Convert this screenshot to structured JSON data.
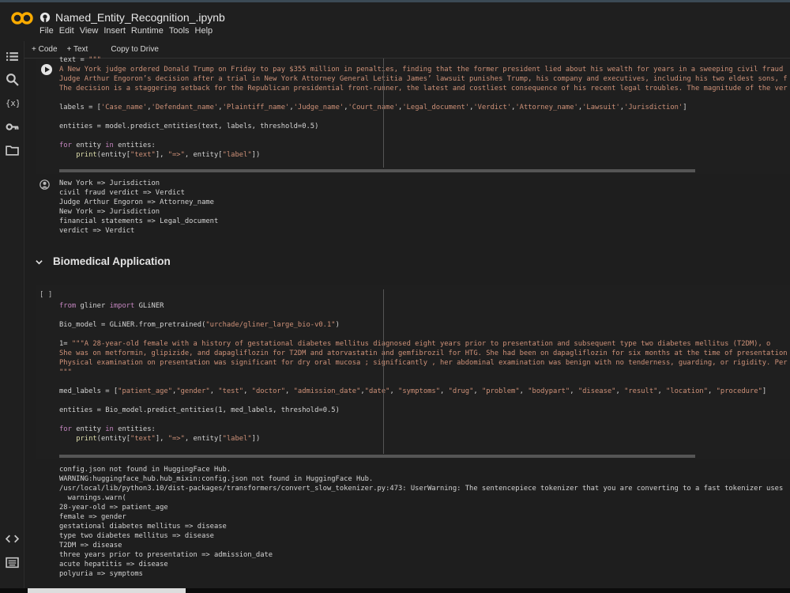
{
  "app": {
    "title": "Named_Entity_Recognition_.ipynb",
    "menu": [
      "File",
      "Edit",
      "View",
      "Insert",
      "Runtime",
      "Tools",
      "Help"
    ]
  },
  "toolbar": {
    "code_label": "+ Code",
    "text_label": "+ Text",
    "drive_label": "Copy to Drive"
  },
  "sidebar": {
    "icons": [
      "toc-icon",
      "search-icon",
      "variables-icon",
      "key-icon",
      "folder-icon",
      "code-snippets-icon",
      "terminal-icon"
    ]
  },
  "cell1": {
    "lines": [
      "text = \"\"\"",
      "A New York judge ordered Donald Trump on Friday to pay $355 million in penalties, finding that the former president lied about his wealth for years in a sweeping civil fraud",
      "Judge Arthur Engoron’s decision after a trial in New York Attorney General Letitia James’ lawsuit punishes Trump, his company and executives, including his two eldest sons, f",
      "The decision is a staggering setback for the Republican presidential front-runner, the latest and costliest consequence of his recent legal troubles. The magnitude of the ver",
      "",
      "labels = ['Case_name','Defendant_name','Plaintiff_name','Judge_name','Court_name','Legal_document','Verdict','Attorney_name','Lawsuit','Jurisdiction']",
      "",
      "entities = model.predict_entities(text, labels, threshold=0.5)",
      "",
      "for entity in entities:",
      "    print(entity[\"text\"], \"=>\", entity[\"label\"])"
    ],
    "output": [
      "New York => Jurisdiction",
      "civil fraud verdict => Verdict",
      "Judge Arthur Engoron => Attorney_name",
      "New York => Jurisdiction",
      "financial statements => Legal_document",
      "verdict => Verdict"
    ]
  },
  "section": {
    "title": "Biomedical Application"
  },
  "cell2": {
    "exec_count": "[ ]",
    "lines": [
      "from gliner import GLiNER",
      "",
      "Bio_model = GLiNER.from_pretrained(\"urchade/gliner_large_bio-v0.1\")",
      "",
      "text_1= \"\"\"A 28-year-old female with a history of gestational diabetes mellitus diagnosed eight years prior to presentation and subsequent type two diabetes mellitus (T2DM), o",
      "She was on metformin, glipizide, and dapagliflozin for T2DM and atorvastatin and gemfibrozil for HTG. She had been on dapagliflozin for six months at the time of presentation",
      "Physical examination on presentation was significant for dry oral mucosa ; significantly , her abdominal examination was benign with no tenderness, guarding, or rigidity. Per",
      "\"\"\"",
      "",
      "med_labels = [\"patient_age\",\"gender\", \"test\", \"doctor\", \"admission_date\",\"date\", \"symptoms\", \"drug\", \"problem\", \"bodypart\", \"disease\", \"result\", \"location\", \"procedure\"]",
      "",
      "entities = Bio_model.predict_entities(text_1, med_labels, threshold=0.5)",
      "",
      "for entity in entities:",
      "    print(entity[\"text\"], \"=>\", entity[\"label\"])"
    ],
    "output": [
      "config.json not found in HuggingFace Hub.",
      "WARNING:huggingface_hub.hub_mixin:config.json not found in HuggingFace Hub.",
      "/usr/local/lib/python3.10/dist-packages/transformers/convert_slow_tokenizer.py:473: UserWarning: The sentencepiece tokenizer that you are converting to a fast tokenizer uses",
      "  warnings.warn(",
      "28-year-old => patient_age",
      "female => gender",
      "gestational diabetes mellitus => disease",
      "type two diabetes mellitus => disease",
      "T2DM => disease",
      "three years prior to presentation => admission_date",
      "acute hepatitis => disease",
      "polyuria => symptoms"
    ]
  },
  "colors": {
    "accent": "#f9ab00",
    "background": "#1e1e1e",
    "string": "#ce9178",
    "keyword": "#c586c0"
  }
}
